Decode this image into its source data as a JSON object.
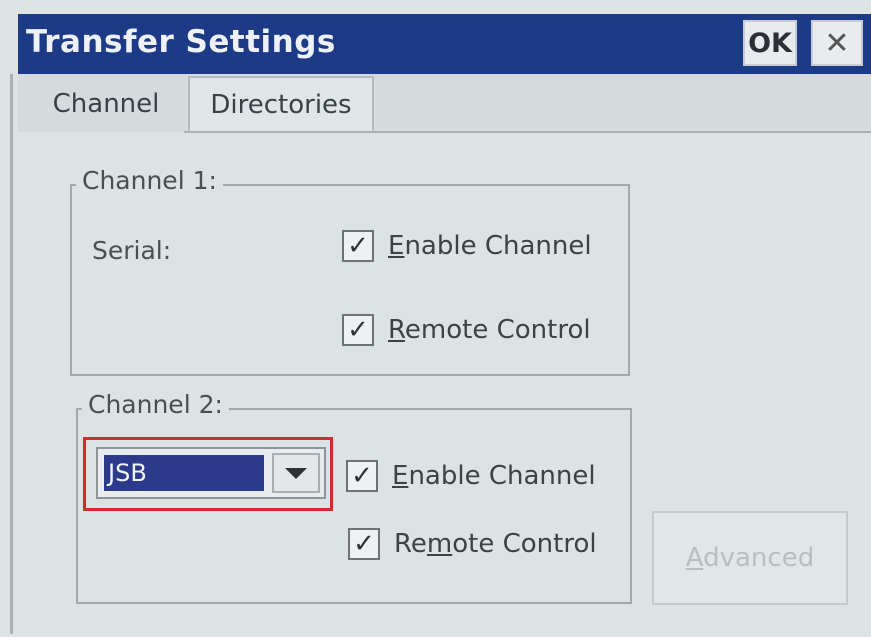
{
  "window": {
    "title": "Transfer Settings",
    "ok_label": "OK",
    "close_label": "✕"
  },
  "tabs": [
    {
      "label": "Channel",
      "selected": true
    },
    {
      "label": "Directories",
      "selected": false
    }
  ],
  "channel1": {
    "legend": "Channel 1:",
    "type_label": "Serial:",
    "enable": {
      "label_pre": "",
      "label_mnemonic": "E",
      "label_post": "nable Channel",
      "checked": true
    },
    "remote": {
      "label_pre": "",
      "label_mnemonic": "R",
      "label_post": "emote Control",
      "checked": true
    }
  },
  "channel2": {
    "legend": "Channel 2:",
    "combo_value": "JSB",
    "enable": {
      "label_pre": "",
      "label_mnemonic": "E",
      "label_post": "nable Channel",
      "checked": true
    },
    "remote": {
      "label_pre": "Re",
      "label_mnemonic": "m",
      "label_post": "ote Control",
      "checked": true
    }
  },
  "advanced": {
    "label_mnemonic": "A",
    "label_post": "dvanced",
    "enabled": false
  },
  "checkmark": "✓",
  "colors": {
    "titlebar": "#1d3a86",
    "highlight": "#d42b2b",
    "selection": "#2b3a8a"
  }
}
